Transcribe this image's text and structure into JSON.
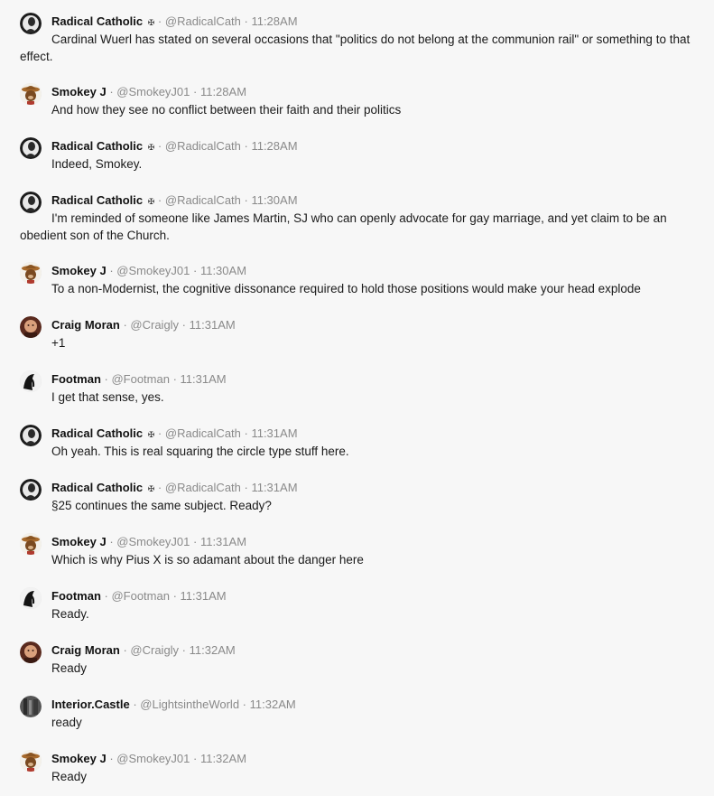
{
  "messages": [
    {
      "author": "Radical Catholic",
      "badge": "✠",
      "handle": "@RadicalCath",
      "time": "11:28AM",
      "avatar": "radical",
      "text": "Cardinal Wuerl has stated on several occasions that \"politics do not belong at the communion rail\" or something to that effect."
    },
    {
      "author": "Smokey J",
      "badge": "",
      "handle": "@SmokeyJ01",
      "time": "11:28AM",
      "avatar": "smokey",
      "text": "And how they see no conflict between their faith and their politics"
    },
    {
      "author": "Radical Catholic",
      "badge": "✠",
      "handle": "@RadicalCath",
      "time": "11:28AM",
      "avatar": "radical",
      "text": "Indeed, Smokey."
    },
    {
      "author": "Radical Catholic",
      "badge": "✠",
      "handle": "@RadicalCath",
      "time": "11:30AM",
      "avatar": "radical",
      "text": "I'm reminded of someone like James Martin, SJ who can openly advocate for gay marriage, and yet claim to be an obedient son of the Church."
    },
    {
      "author": "Smokey J",
      "badge": "",
      "handle": "@SmokeyJ01",
      "time": "11:30AM",
      "avatar": "smokey",
      "text": "To a non-Modernist, the cognitive dissonance required to hold those positions would make your head explode"
    },
    {
      "author": "Craig Moran",
      "badge": "",
      "handle": "@Craigly",
      "time": "11:31AM",
      "avatar": "craig",
      "text": "+1"
    },
    {
      "author": "Footman",
      "badge": "",
      "handle": "@Footman",
      "time": "11:31AM",
      "avatar": "footman",
      "text": "I get that sense, yes."
    },
    {
      "author": "Radical Catholic",
      "badge": "✠",
      "handle": "@RadicalCath",
      "time": "11:31AM",
      "avatar": "radical",
      "text": "Oh yeah. This is real squaring the circle type stuff here."
    },
    {
      "author": "Radical Catholic",
      "badge": "✠",
      "handle": "@RadicalCath",
      "time": "11:31AM",
      "avatar": "radical",
      "text": "§25 continues the same subject. Ready?"
    },
    {
      "author": "Smokey J",
      "badge": "",
      "handle": "@SmokeyJ01",
      "time": "11:31AM",
      "avatar": "smokey",
      "text": "Which is why Pius X is so adamant about the danger here"
    },
    {
      "author": "Footman",
      "badge": "",
      "handle": "@Footman",
      "time": "11:31AM",
      "avatar": "footman",
      "text": "Ready."
    },
    {
      "author": "Craig Moran",
      "badge": "",
      "handle": "@Craigly",
      "time": "11:32AM",
      "avatar": "craig",
      "text": "Ready"
    },
    {
      "author": "Interior.Castle",
      "badge": "",
      "handle": "@LightsintheWorld",
      "time": "11:32AM",
      "avatar": "castle",
      "text": "ready"
    },
    {
      "author": "Smokey J",
      "badge": "",
      "handle": "@SmokeyJ01",
      "time": "11:32AM",
      "avatar": "smokey",
      "text": "Ready"
    }
  ]
}
